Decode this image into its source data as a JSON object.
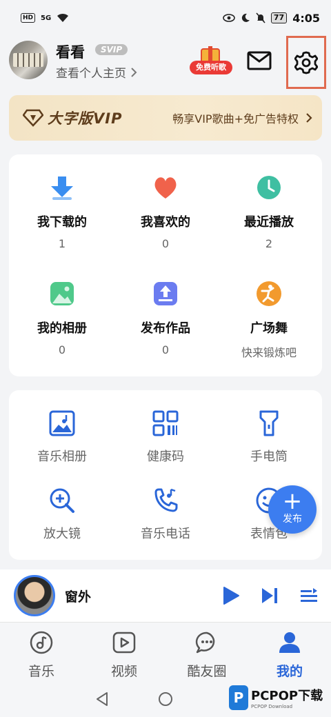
{
  "status_bar": {
    "hd": "HD",
    "network": "5G",
    "battery": "77",
    "time": "4:05"
  },
  "profile": {
    "username": "看看",
    "badge": "SVIP",
    "homepage_link": "查看个人主页",
    "gift_tag": "免费听歌"
  },
  "vip_banner": {
    "title": "大字版VIP",
    "description": "畅享VIP歌曲+免广告特权"
  },
  "stats": [
    {
      "label": "我下载的",
      "value": "1",
      "icon": "download-icon",
      "color": "#3a8ef0"
    },
    {
      "label": "我喜欢的",
      "value": "0",
      "icon": "heart-icon",
      "color": "#f0624b"
    },
    {
      "label": "最近播放",
      "value": "2",
      "icon": "clock-icon",
      "color": "#3fbfa2"
    },
    {
      "label": "我的相册",
      "value": "0",
      "icon": "photo-icon",
      "color": "#4fc98a"
    },
    {
      "label": "发布作品",
      "value": "0",
      "icon": "upload-icon",
      "color": "#6b7cf0"
    },
    {
      "label": "广场舞",
      "value": "快来锻炼吧",
      "icon": "dancer-icon",
      "color": "#f29a2e"
    }
  ],
  "tools": [
    {
      "label": "音乐相册",
      "icon": "music-album-icon"
    },
    {
      "label": "健康码",
      "icon": "qr-code-icon"
    },
    {
      "label": "手电筒",
      "icon": "flashlight-icon"
    },
    {
      "label": "放大镜",
      "icon": "magnifier-icon"
    },
    {
      "label": "音乐电话",
      "icon": "music-phone-icon"
    },
    {
      "label": "表情包",
      "icon": "emoji-icon"
    }
  ],
  "fab": {
    "label": "发布"
  },
  "player": {
    "title": "窗外"
  },
  "tabs": [
    {
      "label": "音乐",
      "icon": "music-note-icon"
    },
    {
      "label": "视频",
      "icon": "video-play-icon"
    },
    {
      "label": "酷友圈",
      "icon": "chat-bubble-icon"
    },
    {
      "label": "我的",
      "icon": "user-icon"
    }
  ],
  "watermark": {
    "brand": "PCPOP下载",
    "sub": "PCPOP Download"
  },
  "colors": {
    "accent": "#3c7df0",
    "active_tab": "#2a66d8",
    "highlight_box": "#e06a4f"
  }
}
